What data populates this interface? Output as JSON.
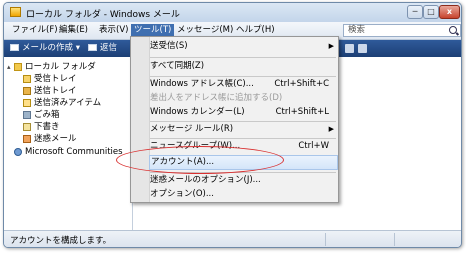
{
  "window": {
    "title": "ローカル フォルダ - Windows メール",
    "min_glyph": "─",
    "max_glyph": "□",
    "close_glyph": "x"
  },
  "menubar": {
    "items": [
      {
        "label": "ファイル(F)"
      },
      {
        "label": "編集(E)"
      },
      {
        "label": "表示(V)"
      },
      {
        "label": "ツール(T)"
      },
      {
        "label": "メッセージ(M)"
      },
      {
        "label": "ヘルプ(H)"
      }
    ]
  },
  "search": {
    "placeholder": "検索"
  },
  "toolbar": {
    "new_mail_label": "メールの作成 ▾",
    "partial_label": "返信"
  },
  "tree": {
    "root": "ローカル フォルダ",
    "items": [
      {
        "label": "受信トレイ"
      },
      {
        "label": "送信トレイ"
      },
      {
        "label": "送信済みアイテム"
      },
      {
        "label": "ごみ箱"
      },
      {
        "label": "下書き"
      },
      {
        "label": "迷惑メール"
      }
    ],
    "communities": "Microsoft Communities"
  },
  "tools_menu": {
    "items": [
      {
        "label": "送受信(S)",
        "shortcut": "",
        "submenu": true
      },
      {
        "label": "すべて同期(Z)",
        "shortcut": ""
      },
      {
        "label": "Windows アドレス帳(C)...",
        "shortcut": "Ctrl+Shift+C"
      },
      {
        "label": "差出人をアドレス帳に追加する(D)",
        "shortcut": "",
        "disabled": true
      },
      {
        "label": "Windows カレンダー(L)",
        "shortcut": "Ctrl+Shift+L"
      },
      {
        "label": "メッセージ ルール(R)",
        "shortcut": "",
        "submenu": true
      },
      {
        "label": "ニュースグループ(W)...",
        "shortcut": "Ctrl+W"
      },
      {
        "label": "アカウント(A)...",
        "shortcut": "",
        "highlighted": true
      },
      {
        "label": "迷惑メールのオプション(J)...",
        "shortcut": ""
      },
      {
        "label": "オプション(O)...",
        "shortcut": ""
      }
    ]
  },
  "statusbar": {
    "text": "アカウントを構成します。"
  },
  "colors": {
    "toolbar": "#1c3f75",
    "menu_active": "#3f6fb0",
    "annotation": "#d93030"
  }
}
